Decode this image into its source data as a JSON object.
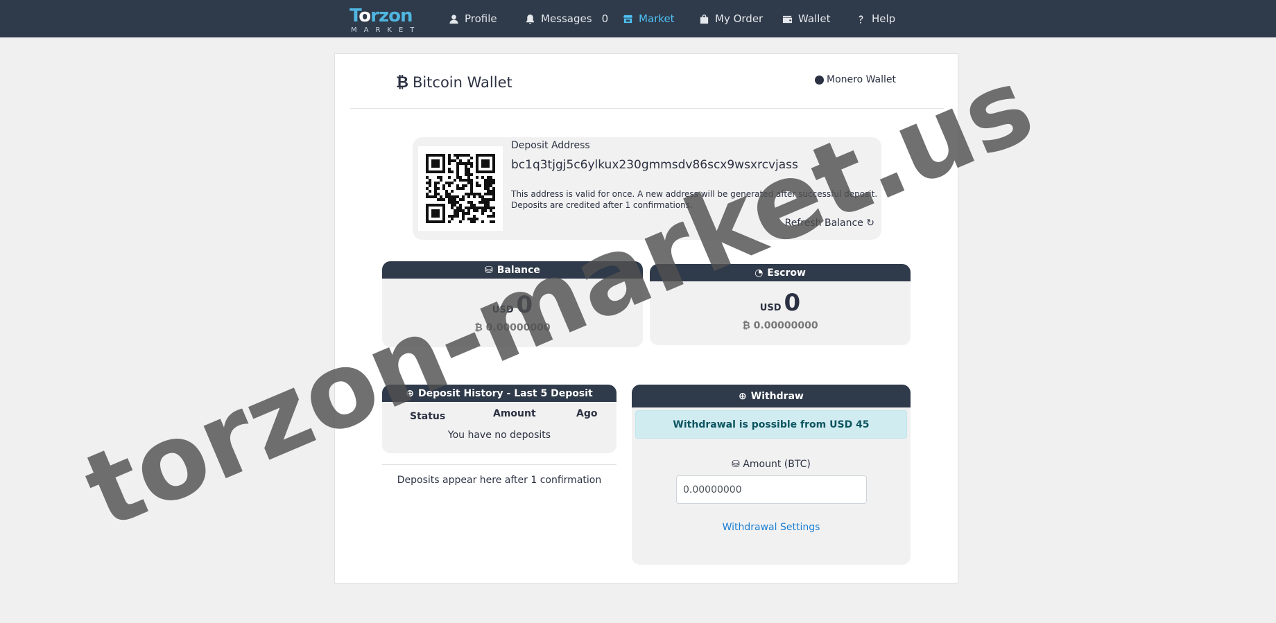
{
  "navbar": {
    "logo_text": "Torzon",
    "logo_sub": "MARKET",
    "items": [
      {
        "label": "Profile",
        "icon": "user-icon"
      },
      {
        "label": "Messages",
        "count": "0",
        "icon": "bell-icon"
      },
      {
        "label": "Market",
        "icon": "store-icon",
        "active": true
      },
      {
        "label": "My Order",
        "icon": "bag-icon"
      },
      {
        "label": "Wallet",
        "icon": "wallet-icon"
      },
      {
        "label": "Help",
        "icon": "question-icon"
      }
    ]
  },
  "wallet": {
    "title": "Bitcoin Wallet",
    "title_icon": "bitcoin-icon",
    "monero_link": "Monero Wallet"
  },
  "deposit": {
    "label": "Deposit Address",
    "address": "bc1q3tjgj5c6ylkux230gmmsdv86scx9wsxrcvjass",
    "note_line1": "This address is valid for once. A new address will be generated after successful deposit.",
    "note_line2": "Deposits are credited after 1 confirmations.",
    "refresh": "Refresh Balance ↻"
  },
  "balance": {
    "title": "Balance",
    "currency": "USD",
    "usd": "0",
    "btc": "₿ 0.00000000"
  },
  "escrow": {
    "title": "Escrow",
    "currency": "USD",
    "usd": "0",
    "btc": "₿ 0.00000000"
  },
  "history": {
    "title": "Deposit History - Last 5 Deposit",
    "columns": [
      "Status",
      "Amount",
      "Ago"
    ],
    "empty": "You have no deposits",
    "footer": "Deposits appear here after 1 confirmation"
  },
  "withdraw": {
    "title": "Withdraw",
    "alert": "Withdrawal is possible from USD 45",
    "amount_label": "Amount (BTC)",
    "amount_value": "0.00000000",
    "settings_link": "Withdrawal Settings"
  },
  "watermark": "torzon-market.us",
  "colors": {
    "navbar_bg": "#2f3a4a",
    "active_nav": "#4fc3f7",
    "link": "#1a7fd4",
    "alert_bg": "#d1ecf1"
  }
}
